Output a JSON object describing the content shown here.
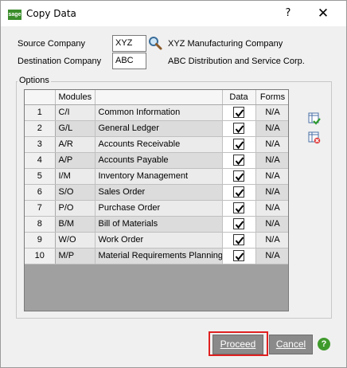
{
  "window": {
    "title": "Copy Data",
    "app_icon_text": "sage",
    "help_symbol": "?",
    "close_symbol": "✕"
  },
  "source": {
    "label": "Source Company",
    "code": "XYZ",
    "name": "XYZ Manufacturing Company"
  },
  "destination": {
    "label": "Destination Company",
    "code": "ABC",
    "name": "ABC Distribution and Service Corp."
  },
  "options": {
    "title": "Options",
    "columns": [
      "",
      "Modules",
      "",
      "Data",
      "Forms"
    ],
    "rows": [
      {
        "num": "1",
        "code": "C/I",
        "name": "Common Information",
        "data": true,
        "forms": "N/A"
      },
      {
        "num": "2",
        "code": "G/L",
        "name": "General Ledger",
        "data": true,
        "forms": "N/A"
      },
      {
        "num": "3",
        "code": "A/R",
        "name": "Accounts Receivable",
        "data": true,
        "forms": "N/A"
      },
      {
        "num": "4",
        "code": "A/P",
        "name": "Accounts Payable",
        "data": true,
        "forms": "N/A"
      },
      {
        "num": "5",
        "code": "I/M",
        "name": "Inventory Management",
        "data": true,
        "forms": "N/A"
      },
      {
        "num": "6",
        "code": "S/O",
        "name": "Sales Order",
        "data": true,
        "forms": "N/A"
      },
      {
        "num": "7",
        "code": "P/O",
        "name": "Purchase Order",
        "data": true,
        "forms": "N/A"
      },
      {
        "num": "8",
        "code": "B/M",
        "name": "Bill of Materials",
        "data": true,
        "forms": "N/A"
      },
      {
        "num": "9",
        "code": "W/O",
        "name": "Work Order",
        "data": true,
        "forms": "N/A"
      },
      {
        "num": "10",
        "code": "M/P",
        "name": "Material Requirements Planning",
        "data": true,
        "forms": "N/A"
      }
    ]
  },
  "buttons": {
    "proceed": "Proceed",
    "cancel": "Cancel",
    "help": "?"
  },
  "colors": {
    "highlight_outline": "#e02020",
    "button_bg": "#8a8a8a",
    "help_green": "#3f9a2c"
  }
}
